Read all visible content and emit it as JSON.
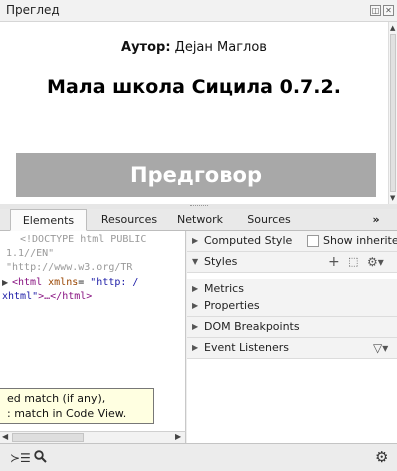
{
  "preview": {
    "title": "Преглед",
    "btn_float": "◫",
    "btn_close": "✕",
    "author_label": "Аутор:",
    "author_name": " Дејан Маглов",
    "book_title": "Мала школа Сицила 0.7.2.",
    "preface": "Предговор"
  },
  "devtools": {
    "tabs": [
      "Elements",
      "Resources",
      "Network",
      "Sources"
    ],
    "more": "»",
    "elements": {
      "doctype_1": "<!DOCTYPE html PUBLIC",
      "doctype_2": "1.1//EN\"",
      "doctype_3": "\"http://www.w3.org/TR",
      "html_open": "<html",
      "html_attr": " xmlns",
      "html_eq": "= ",
      "html_val": "\"http: /",
      "html_line2_val": "xhtml\"",
      "html_line2_rest": ">…</html>",
      "tooltip_1": "ed match (if any),",
      "tooltip_2": ": match in Code View."
    },
    "sidebar": {
      "computed_style": "Computed Style",
      "show_inherited": "Show inherited",
      "styles": "Styles",
      "styles_add": "+",
      "metrics": "Metrics",
      "properties": "Properties",
      "dom_breakpoints": "DOM Breakpoints",
      "event_listeners": "Event Listeners"
    },
    "bottom": {
      "console": "≻☰",
      "search": "🔍",
      "settings": "⚙"
    }
  }
}
